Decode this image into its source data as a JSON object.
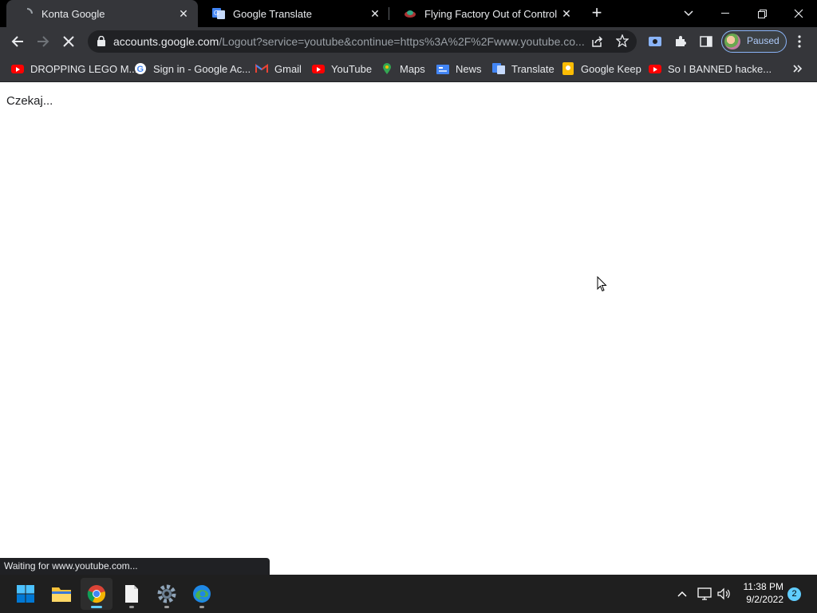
{
  "tabs": [
    {
      "title": "Konta Google",
      "active": true
    },
    {
      "title": "Google Translate",
      "active": false
    },
    {
      "title": "Flying Factory Out of Control | PJ",
      "active": false
    }
  ],
  "omnibox": {
    "host": "accounts.google.com",
    "path": "/Logout?service=youtube&continue=https%3A%2F%2Fwww.youtube.co..."
  },
  "profile": {
    "label": "Paused"
  },
  "bookmarks": [
    {
      "label": "DROPPING LEGO M...",
      "icon": "youtube-icon"
    },
    {
      "label": "Sign in - Google Ac...",
      "icon": "google-icon"
    },
    {
      "label": "Gmail",
      "icon": "gmail-icon"
    },
    {
      "label": "YouTube",
      "icon": "youtube-icon"
    },
    {
      "label": "Maps",
      "icon": "maps-icon"
    },
    {
      "label": "News",
      "icon": "news-icon"
    },
    {
      "label": "Translate",
      "icon": "translate-icon"
    },
    {
      "label": "Google Keep",
      "icon": "keep-icon"
    },
    {
      "label": "So I BANNED hacke...",
      "icon": "youtube-icon"
    }
  ],
  "page": {
    "message": "Czekaj..."
  },
  "status": {
    "text": "Waiting for www.youtube.com..."
  },
  "taskbar": {
    "time": "11:38 PM",
    "date": "9/2/2022",
    "notifications": "2"
  },
  "colors": {
    "chrome_dark": "#202124",
    "tab_active": "#35363a",
    "accent": "#60cdff",
    "profile_border": "#8ab4f8"
  }
}
